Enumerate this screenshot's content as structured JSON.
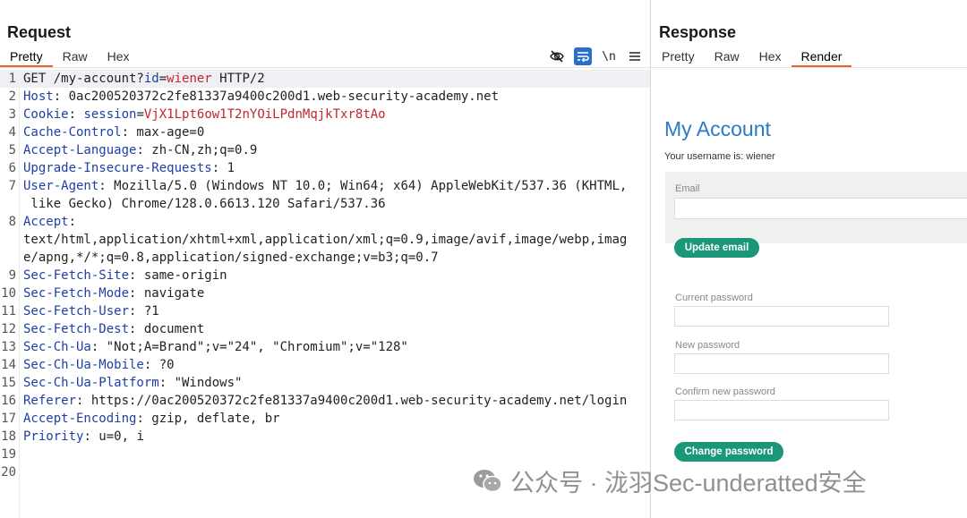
{
  "request": {
    "title": "Request",
    "tabs": [
      "Pretty",
      "Raw",
      "Hex"
    ],
    "active_tab": "Pretty",
    "tools": [
      "eye-off-icon",
      "wrap-icon",
      "newline-icon",
      "menu-icon"
    ],
    "newline_label": "\\n",
    "lines": [
      {
        "n": "1",
        "parts": [
          [
            "p",
            "GET /my-account?"
          ],
          [
            "k",
            "id"
          ],
          [
            "p",
            "="
          ],
          [
            "v",
            "wiener"
          ],
          [
            "p",
            " HTTP/2"
          ]
        ]
      },
      {
        "n": "2",
        "parts": [
          [
            "k",
            "Host"
          ],
          [
            "p",
            ": 0ac200520372c2fe81337a9400c200d1.web-security-academy.net"
          ]
        ]
      },
      {
        "n": "3",
        "parts": [
          [
            "k",
            "Cookie"
          ],
          [
            "p",
            ": "
          ],
          [
            "k",
            "session"
          ],
          [
            "p",
            "="
          ],
          [
            "v",
            "VjX1Lpt6ow1T2nYOiLPdnMqjkTxr8tAo"
          ]
        ]
      },
      {
        "n": "4",
        "parts": [
          [
            "k",
            "Cache-Control"
          ],
          [
            "p",
            ": max-age=0"
          ]
        ]
      },
      {
        "n": "5",
        "parts": [
          [
            "k",
            "Accept-Language"
          ],
          [
            "p",
            ": zh-CN,zh;q=0.9"
          ]
        ]
      },
      {
        "n": "6",
        "parts": [
          [
            "k",
            "Upgrade-Insecure-Requests"
          ],
          [
            "p",
            ": 1"
          ]
        ]
      },
      {
        "n": "7",
        "parts": [
          [
            "k",
            "User-Agent"
          ],
          [
            "p",
            ": Mozilla/5.0 (Windows NT 10.0; Win64; x64) AppleWebKit/537.36 (KHTML,"
          ]
        ]
      },
      {
        "n": "",
        "parts": [
          [
            "p",
            " like Gecko) Chrome/128.0.6613.120 Safari/537.36"
          ]
        ]
      },
      {
        "n": "8",
        "parts": [
          [
            "k",
            "Accept"
          ],
          [
            "p",
            ":"
          ]
        ]
      },
      {
        "n": "",
        "parts": [
          [
            "p",
            "text/html,application/xhtml+xml,application/xml;q=0.9,image/avif,image/webp,imag"
          ]
        ]
      },
      {
        "n": "",
        "parts": [
          [
            "p",
            "e/apng,*/*;q=0.8,application/signed-exchange;v=b3;q=0.7"
          ]
        ]
      },
      {
        "n": "9",
        "parts": [
          [
            "k",
            "Sec-Fetch-Site"
          ],
          [
            "p",
            ": same-origin"
          ]
        ]
      },
      {
        "n": "10",
        "parts": [
          [
            "k",
            "Sec-Fetch-Mode"
          ],
          [
            "p",
            ": navigate"
          ]
        ]
      },
      {
        "n": "11",
        "parts": [
          [
            "k",
            "Sec-Fetch-User"
          ],
          [
            "p",
            ": ?1"
          ]
        ]
      },
      {
        "n": "12",
        "parts": [
          [
            "k",
            "Sec-Fetch-Dest"
          ],
          [
            "p",
            ": document"
          ]
        ]
      },
      {
        "n": "13",
        "parts": [
          [
            "k",
            "Sec-Ch-Ua"
          ],
          [
            "p",
            ": \"Not;A=Brand\";v=\"24\", \"Chromium\";v=\"128\""
          ]
        ]
      },
      {
        "n": "14",
        "parts": [
          [
            "k",
            "Sec-Ch-Ua-Mobile"
          ],
          [
            "p",
            ": ?0"
          ]
        ]
      },
      {
        "n": "15",
        "parts": [
          [
            "k",
            "Sec-Ch-Ua-Platform"
          ],
          [
            "p",
            ": \"Windows\""
          ]
        ]
      },
      {
        "n": "16",
        "parts": [
          [
            "k",
            "Referer"
          ],
          [
            "p",
            ": https://0ac200520372c2fe81337a9400c200d1.web-security-academy.net/login"
          ]
        ]
      },
      {
        "n": "17",
        "parts": [
          [
            "k",
            "Accept-Encoding"
          ],
          [
            "p",
            ": gzip, deflate, br"
          ]
        ]
      },
      {
        "n": "18",
        "parts": [
          [
            "k",
            "Priority"
          ],
          [
            "p",
            ": u=0, i"
          ]
        ]
      },
      {
        "n": "19",
        "parts": []
      },
      {
        "n": "20",
        "parts": []
      }
    ]
  },
  "response": {
    "title": "Response",
    "tabs": [
      "Pretty",
      "Raw",
      "Hex",
      "Render"
    ],
    "active_tab": "Render",
    "render": {
      "heading": "My Account",
      "username_text": "Your username is: wiener",
      "email_label": "Email",
      "update_email_button": "Update email",
      "current_password_label": "Current password",
      "new_password_label": "New password",
      "confirm_password_label": "Confirm new password",
      "change_password_button": "Change password"
    }
  },
  "watermark": {
    "text": "公众号 · 泷羽Sec-underatted安全"
  },
  "colors": {
    "key": "#1f3fa6",
    "value": "#c2262e",
    "accent_tab": "#e8622c",
    "button_green": "#1a9678",
    "heading_blue": "#2b7ac6"
  }
}
